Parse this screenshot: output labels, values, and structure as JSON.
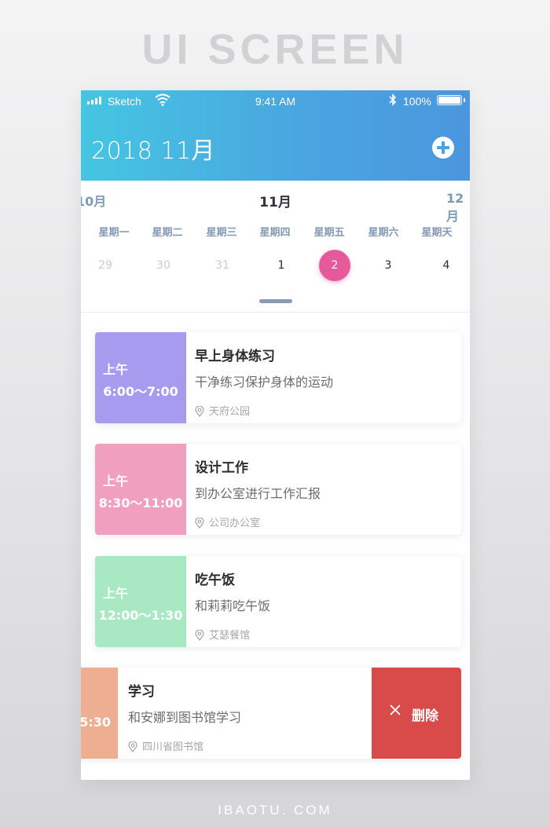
{
  "showcase": {
    "title": "UI SCREEN",
    "footer": "IBAOTU. COM"
  },
  "status_bar": {
    "carrier": "Sketch",
    "time": "9:41 AM",
    "battery": "100%"
  },
  "header": {
    "title": "2018 11月",
    "add_icon": "plus-circle-icon"
  },
  "month_nav": {
    "prev": "10月",
    "current": "11月",
    "next": "12月"
  },
  "weekdays": [
    "星期一",
    "星期二",
    "星期三",
    "星期四",
    "星期五",
    "星期六",
    "星期天"
  ],
  "dates": [
    {
      "label": "29",
      "state": "dim"
    },
    {
      "label": "30",
      "state": "dim"
    },
    {
      "label": "31",
      "state": "dim"
    },
    {
      "label": "1",
      "state": "normal"
    },
    {
      "label": "2",
      "state": "selected"
    },
    {
      "label": "3",
      "state": "normal"
    },
    {
      "label": "4",
      "state": "normal"
    }
  ],
  "events": [
    {
      "ampm": "上午",
      "range": "6:00～7:00",
      "title": "早上身体练习",
      "desc": "干净练习保护身体的运动",
      "location": "天府公园",
      "color": "#a79bef"
    },
    {
      "ampm": "上午",
      "range": "8:30～11:00",
      "title": "设计工作",
      "desc": "到办公室进行工作汇报",
      "location": "公司办公室",
      "color": "#f09fbf"
    },
    {
      "ampm": "上午",
      "range": "12:00～1:30",
      "title": "吃午饭",
      "desc": "和莉莉吃午饭",
      "location": "艾瑟餐馆",
      "color": "#a8e9c3"
    }
  ],
  "swiped_event": {
    "range": "5:30",
    "title": "学习",
    "desc": "和安娜到图书馆学习",
    "location": "四川省图书馆",
    "color": "#eeae92",
    "delete_label": "删除"
  },
  "colors": {
    "header_start": "#45c6e2",
    "header_end": "#4b96df",
    "selected_date": "#e65a9b",
    "delete": "#d94a4b"
  }
}
